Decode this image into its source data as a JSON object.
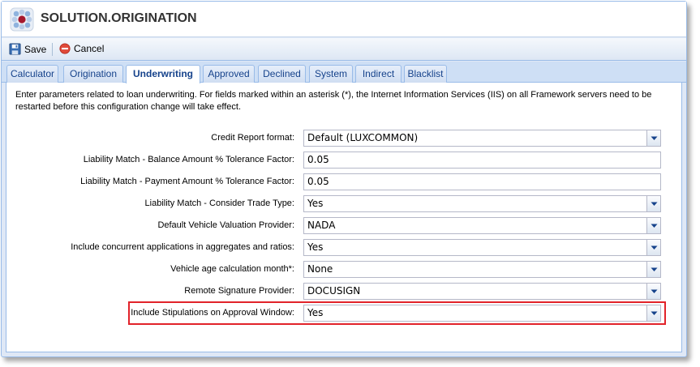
{
  "app": {
    "title": "SOLUTION.ORIGINATION"
  },
  "toolbar": {
    "save_label": "Save",
    "cancel_label": "Cancel"
  },
  "tabs": [
    {
      "label": "Calculator",
      "active": false
    },
    {
      "label": "Origination",
      "active": false
    },
    {
      "label": "Underwriting",
      "active": true
    },
    {
      "label": "Approved",
      "active": false
    },
    {
      "label": "Declined",
      "active": false
    },
    {
      "label": "System",
      "active": false
    },
    {
      "label": "Indirect",
      "active": false
    },
    {
      "label": "Blacklist",
      "active": false
    }
  ],
  "intro": {
    "line1": "Enter parameters related to loan underwriting. For fields marked within an asterisk (*), the Internet Information Services (IIS) on all Framework servers need to be",
    "line2": "restarted before this configuration change will take effect."
  },
  "fields": [
    {
      "label": "Credit Report format:",
      "value": "Default (LUXCOMMON)",
      "type": "combo"
    },
    {
      "label": "Liability Match - Balance Amount % Tolerance Factor:",
      "value": "0.05",
      "type": "text"
    },
    {
      "label": "Liability Match - Payment Amount % Tolerance Factor:",
      "value": "0.05",
      "type": "text"
    },
    {
      "label": "Liability Match - Consider Trade Type:",
      "value": "Yes",
      "type": "combo"
    },
    {
      "label": "Default Vehicle Valuation Provider:",
      "value": "NADA",
      "type": "combo"
    },
    {
      "label": "Include concurrent applications in aggregates and ratios:",
      "value": "Yes",
      "type": "combo"
    },
    {
      "label": "Vehicle age calculation month*:",
      "value": "None",
      "type": "combo"
    },
    {
      "label": "Remote Signature Provider:",
      "value": "DOCUSIGN",
      "type": "combo"
    },
    {
      "label": "Include Stipulations on Approval Window:",
      "value": "Yes",
      "type": "combo"
    }
  ],
  "colors": {
    "accent": "#15428b",
    "border": "#99bbe8",
    "highlight": "#e2232a",
    "window_bg": "#dfe8f6"
  },
  "icons": {
    "logo": "app-logo-icon",
    "save": "floppy-disk-icon",
    "cancel": "cancel-icon",
    "dropdown": "chevron-down-icon"
  }
}
